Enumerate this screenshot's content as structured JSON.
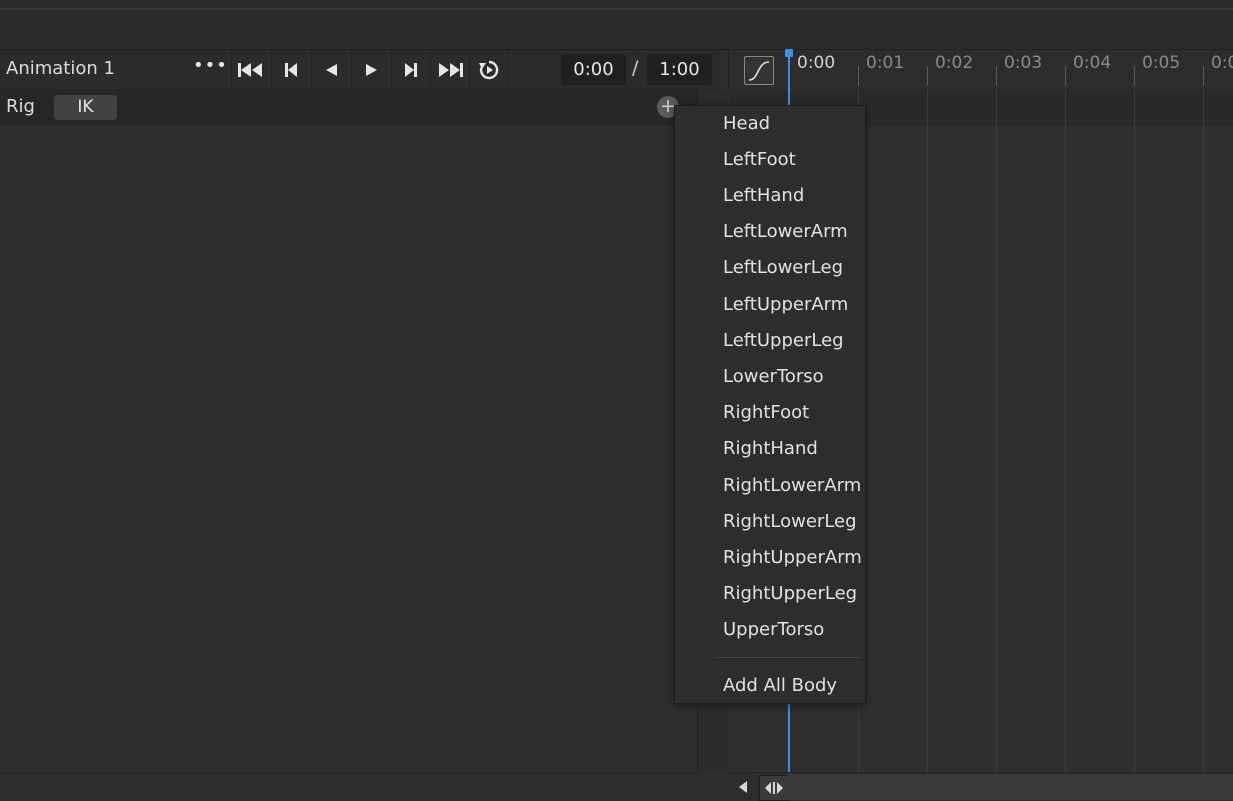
{
  "header": {
    "animation_name": "Animation 1",
    "more_label": "•••",
    "current_time": "0:00",
    "time_separator": "/",
    "total_time": "1:00"
  },
  "rig": {
    "label": "Rig",
    "ik_button": "IK",
    "add_button": "+"
  },
  "timeline": {
    "ticks": [
      "0:00",
      "0:01",
      "0:02",
      "0:03",
      "0:04",
      "0:05",
      "0:0"
    ],
    "accent_color": "#3b8fe6"
  },
  "menu": {
    "items": [
      "Head",
      "LeftFoot",
      "LeftHand",
      "LeftLowerArm",
      "LeftLowerLeg",
      "LeftUpperArm",
      "LeftUpperLeg",
      "LowerTorso",
      "RightFoot",
      "RightHand",
      "RightLowerArm",
      "RightLowerLeg",
      "RightUpperArm",
      "RightUpperLeg",
      "UpperTorso"
    ],
    "add_all": "Add All Body"
  },
  "icons": {
    "transport": [
      "skip-to-start-icon",
      "previous-keyframe-icon",
      "step-back-icon",
      "play-icon",
      "next-keyframe-icon",
      "skip-to-end-icon",
      "loop-icon"
    ],
    "curve": "easing-curve-icon",
    "scroll": [
      "scroll-left-icon",
      "scroll-thumb-icon"
    ]
  }
}
